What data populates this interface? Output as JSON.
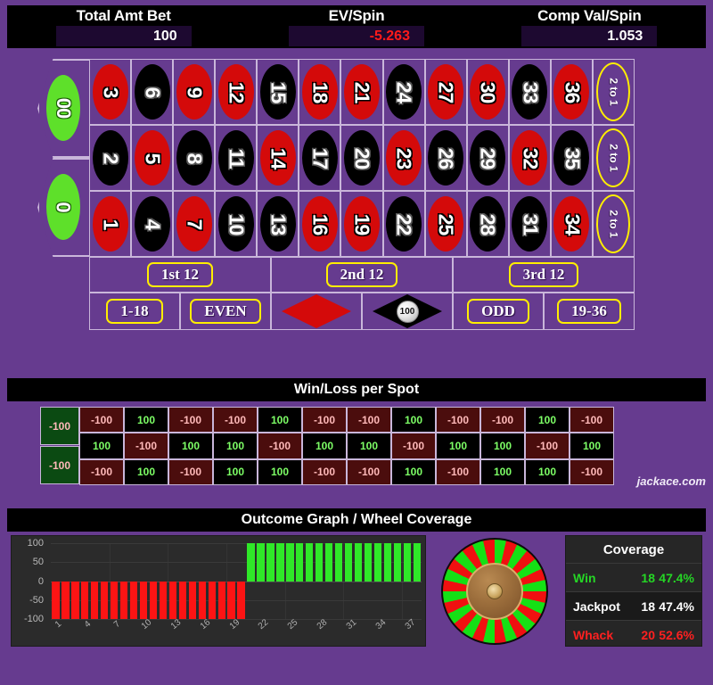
{
  "stats": [
    {
      "label": "Total Amt Bet",
      "value": "100",
      "negative": false
    },
    {
      "label": "EV/Spin",
      "value": "-5.263",
      "negative": true
    },
    {
      "label": "Comp Val/Spin",
      "value": "1.053",
      "negative": false
    }
  ],
  "table": {
    "zeros": [
      {
        "label": "00",
        "color": "green"
      },
      {
        "label": "0",
        "color": "green"
      }
    ],
    "numbers": [
      {
        "n": "3",
        "c": "red"
      },
      {
        "n": "6",
        "c": "black"
      },
      {
        "n": "9",
        "c": "red"
      },
      {
        "n": "12",
        "c": "red"
      },
      {
        "n": "15",
        "c": "black"
      },
      {
        "n": "18",
        "c": "red"
      },
      {
        "n": "21",
        "c": "red"
      },
      {
        "n": "24",
        "c": "black"
      },
      {
        "n": "27",
        "c": "red"
      },
      {
        "n": "30",
        "c": "red"
      },
      {
        "n": "33",
        "c": "black"
      },
      {
        "n": "36",
        "c": "red"
      },
      {
        "n": "2",
        "c": "black"
      },
      {
        "n": "5",
        "c": "red"
      },
      {
        "n": "8",
        "c": "black"
      },
      {
        "n": "11",
        "c": "black"
      },
      {
        "n": "14",
        "c": "red"
      },
      {
        "n": "17",
        "c": "black"
      },
      {
        "n": "20",
        "c": "black"
      },
      {
        "n": "23",
        "c": "red"
      },
      {
        "n": "26",
        "c": "black"
      },
      {
        "n": "29",
        "c": "black"
      },
      {
        "n": "32",
        "c": "red"
      },
      {
        "n": "35",
        "c": "black"
      },
      {
        "n": "1",
        "c": "red"
      },
      {
        "n": "4",
        "c": "black"
      },
      {
        "n": "7",
        "c": "red"
      },
      {
        "n": "10",
        "c": "black"
      },
      {
        "n": "13",
        "c": "black"
      },
      {
        "n": "16",
        "c": "red"
      },
      {
        "n": "19",
        "c": "red"
      },
      {
        "n": "22",
        "c": "black"
      },
      {
        "n": "25",
        "c": "red"
      },
      {
        "n": "28",
        "c": "black"
      },
      {
        "n": "31",
        "c": "black"
      },
      {
        "n": "34",
        "c": "red"
      }
    ],
    "column_bets": [
      "2 to 1",
      "2 to 1",
      "2 to 1"
    ],
    "dozens": [
      "1st 12",
      "2nd 12",
      "3rd 12"
    ],
    "even_money": [
      {
        "type": "text",
        "label": "1-18"
      },
      {
        "type": "text",
        "label": "EVEN"
      },
      {
        "type": "diamond",
        "color": "red",
        "chip": null
      },
      {
        "type": "diamond",
        "color": "black",
        "chip": "100"
      },
      {
        "type": "text",
        "label": "ODD"
      },
      {
        "type": "text",
        "label": "19-36"
      }
    ]
  },
  "winloss": {
    "title": "Win/Loss per Spot",
    "zeros": [
      "-100",
      "-100"
    ],
    "rows": [
      [
        "-100",
        "100",
        "-100",
        "-100",
        "100",
        "-100",
        "-100",
        "100",
        "-100",
        "-100",
        "100",
        "-100"
      ],
      [
        "100",
        "-100",
        "100",
        "100",
        "-100",
        "100",
        "100",
        "-100",
        "100",
        "100",
        "-100",
        "100"
      ],
      [
        "-100",
        "100",
        "-100",
        "100",
        "100",
        "-100",
        "-100",
        "100",
        "-100",
        "100",
        "100",
        "-100"
      ]
    ],
    "brand": "jackace.com"
  },
  "outcome": {
    "title": "Outcome Graph / Wheel Coverage",
    "coverage": {
      "title": "Coverage",
      "rows": [
        {
          "name": "Win",
          "count": "18",
          "pct": "47.4%",
          "style": "win"
        },
        {
          "name": "Jackpot",
          "count": "18",
          "pct": "47.4%",
          "style": "jackpot"
        },
        {
          "name": "Whack",
          "count": "20",
          "pct": "52.6%",
          "style": "whack"
        }
      ]
    }
  },
  "chart_data": {
    "type": "bar",
    "title": "Outcome Graph / Wheel Coverage",
    "xlabel": "",
    "ylabel": "",
    "ylim": [
      -100,
      100
    ],
    "yticks": [
      100,
      50,
      0,
      -50,
      -100
    ],
    "grid": true,
    "legend": "none",
    "categories": [
      "1",
      "2",
      "3",
      "4",
      "5",
      "6",
      "7",
      "8",
      "9",
      "10",
      "11",
      "12",
      "13",
      "14",
      "15",
      "16",
      "17",
      "18",
      "19",
      "20",
      "21",
      "22",
      "23",
      "24",
      "25",
      "26",
      "27",
      "28",
      "29",
      "30",
      "31",
      "32",
      "33",
      "34",
      "35",
      "36",
      "37",
      "38"
    ],
    "tick_labels": [
      "1",
      "4",
      "7",
      "10",
      "13",
      "16",
      "19",
      "22",
      "25",
      "28",
      "31",
      "34",
      "37"
    ],
    "tick_every": 3,
    "values": [
      -100,
      -100,
      -100,
      -100,
      -100,
      -100,
      -100,
      -100,
      -100,
      -100,
      -100,
      -100,
      -100,
      -100,
      -100,
      -100,
      -100,
      -100,
      -100,
      -100,
      100,
      100,
      100,
      100,
      100,
      100,
      100,
      100,
      100,
      100,
      100,
      100,
      100,
      100,
      100,
      100,
      100,
      100
    ],
    "colors": {
      "positive": "#2fe828",
      "negative": "#fc1414",
      "background": "#2b2b2b"
    }
  }
}
